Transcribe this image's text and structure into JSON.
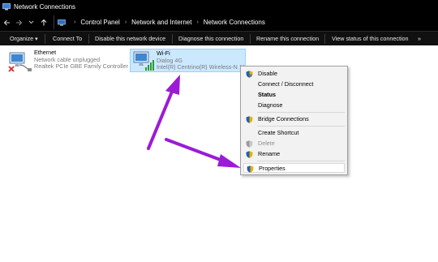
{
  "window": {
    "title": "Network Connections"
  },
  "address": {
    "breadcrumbs": [
      "Control Panel",
      "Network and Internet",
      "Network Connections"
    ]
  },
  "commands": [
    "Organize ▾",
    "Connect To",
    "Disable this network device",
    "Diagnose this connection",
    "Rename this connection",
    "View status of this connection",
    "»"
  ],
  "connections": {
    "ethernet": {
      "name": "Ethernet",
      "status": "Network cable unplugged",
      "device": "Realtek PCIe GBE Family Controller"
    },
    "wifi": {
      "name": "Wi-Fi",
      "status": "Dialog 4G",
      "device": "Intel(R) Centrino(R) Wireless-N 1030"
    }
  },
  "context_menu": {
    "items": [
      {
        "label": "Disable",
        "shield": true,
        "bold": false,
        "disabled": false
      },
      {
        "label": "Connect / Disconnect",
        "shield": false,
        "bold": false,
        "disabled": false
      },
      {
        "label": "Status",
        "shield": false,
        "bold": true,
        "disabled": false
      },
      {
        "label": "Diagnose",
        "shield": false,
        "bold": false,
        "disabled": false
      },
      {
        "label": "Bridge Connections",
        "shield": true,
        "bold": false,
        "disabled": false
      },
      {
        "label": "Create Shortcut",
        "shield": false,
        "bold": false,
        "disabled": false
      },
      {
        "label": "Delete",
        "shield": true,
        "bold": false,
        "disabled": true
      },
      {
        "label": "Rename",
        "shield": true,
        "bold": false,
        "disabled": false
      },
      {
        "label": "Properties",
        "shield": true,
        "bold": false,
        "disabled": false,
        "selected": true
      }
    ]
  },
  "colors": {
    "title_bar": "#000000",
    "selection_fill": "#cce8ff",
    "annotation_arrow": "#9b1bd6"
  },
  "icons": {
    "app": "network-connections-icon",
    "back": "arrow-left-icon",
    "forward": "arrow-right-icon",
    "recent": "chevron-down-icon",
    "up": "arrow-up-icon",
    "ethernet": "ethernet-adapter-icon",
    "wifi": "wifi-adapter-icon",
    "shield": "uac-shield-icon"
  }
}
